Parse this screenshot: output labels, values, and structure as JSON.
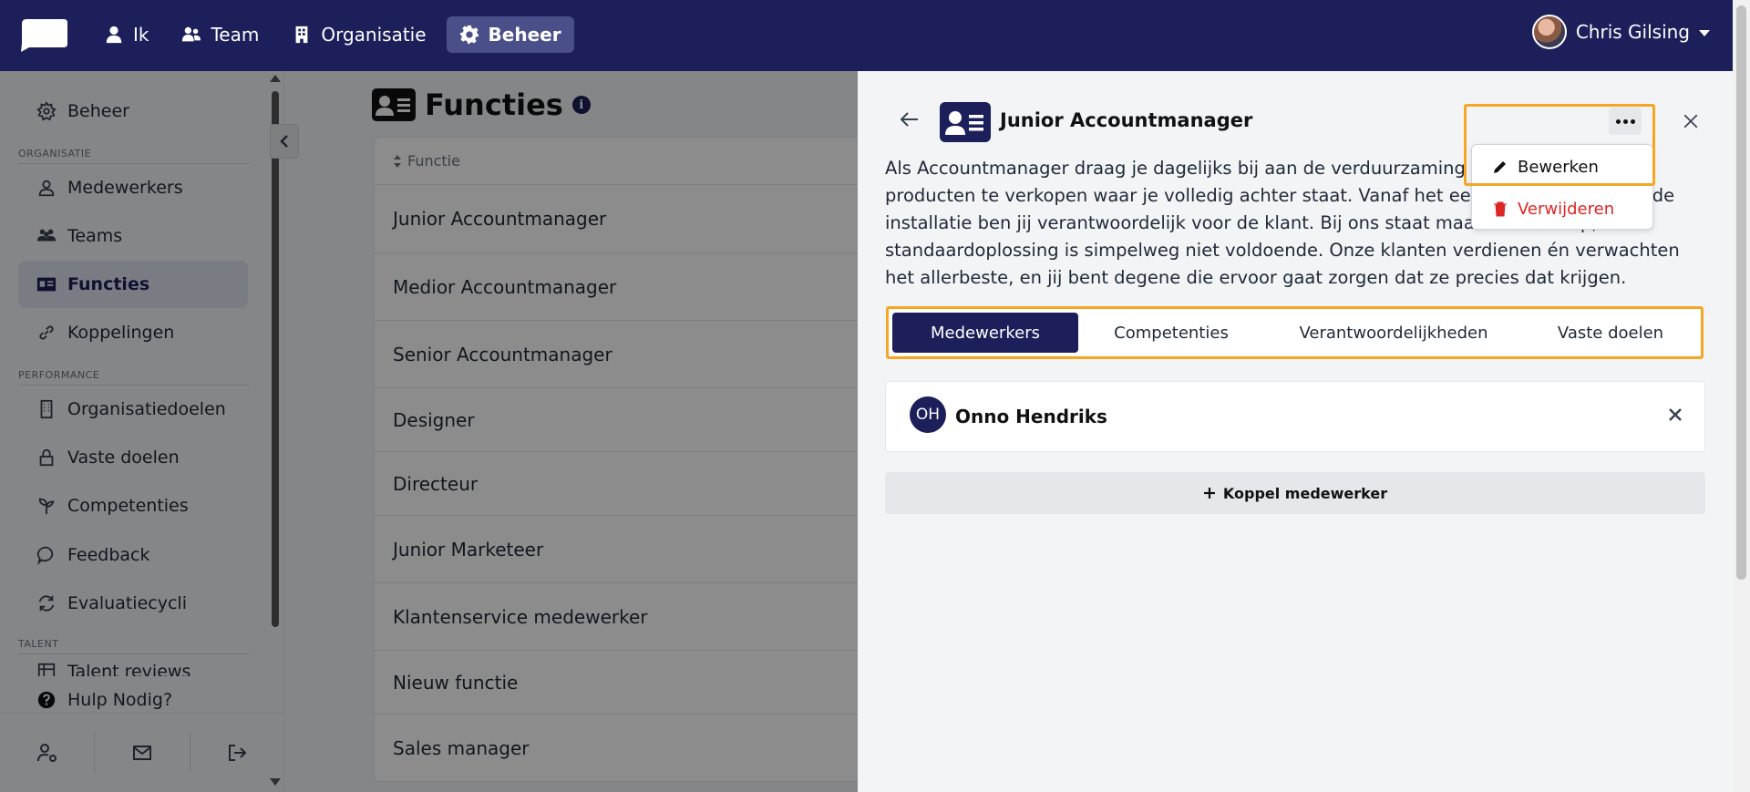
{
  "nav": {
    "items": [
      {
        "label": "Ik",
        "icon": "user-icon"
      },
      {
        "label": "Team",
        "icon": "users-icon"
      },
      {
        "label": "Organisatie",
        "icon": "building-icon"
      },
      {
        "label": "Beheer",
        "icon": "gear-icon",
        "active": true
      }
    ],
    "user_name": "Chris Gilsing"
  },
  "sidebar": {
    "top_item": "Beheer",
    "sections": [
      "ORGANISATIE",
      "PERFORMANCE",
      "TALENT"
    ],
    "items": [
      {
        "label": "Medewerkers"
      },
      {
        "label": "Teams"
      },
      {
        "label": "Functies",
        "active": true
      },
      {
        "label": "Koppelingen"
      },
      {
        "label": "Organisatiedoelen"
      },
      {
        "label": "Vaste doelen"
      },
      {
        "label": "Competenties"
      },
      {
        "label": "Feedback"
      },
      {
        "label": "Evaluatiecycli"
      },
      {
        "label": "Talent reviews"
      }
    ],
    "help": "Hulp Nodig?"
  },
  "main": {
    "title": "Functies",
    "column_header": "Functie",
    "rows": [
      "Junior Accountmanager",
      "Medior Accountmanager",
      "Senior Accountmanager",
      "Designer",
      "Directeur",
      "Junior Marketeer",
      "Klantenservice medewerker",
      "Nieuw functie",
      "Sales manager"
    ]
  },
  "panel": {
    "title": "Junior Accountmanager",
    "description": "Als Accountmanager draag je dagelijks bij aan de verduurzaming van Nederland door producten te verkopen waar je volledig achter staat. Vanaf het eerste contact tot aan de installatie ben jij verantwoordelijk voor de klant. Bij ons staat maatwerk voorop, standaardoplossing is simpelweg niet voldoende. Onze klanten verdienen én verwachten het allerbeste, en jij bent degene die ervoor gaat zorgen dat ze precies dat krijgen.",
    "tabs": [
      "Medewerkers",
      "Competenties",
      "Verantwoordelijkheden",
      "Vaste doelen"
    ],
    "member": {
      "initials": "OH",
      "name": "Onno Hendriks"
    },
    "add_button": "Koppel medewerker",
    "menu": {
      "edit": "Bewerken",
      "delete": "Verwijderen"
    }
  },
  "colors": {
    "brand": "#1c1f5a",
    "highlight": "#f5a623",
    "danger": "#dc2626"
  }
}
